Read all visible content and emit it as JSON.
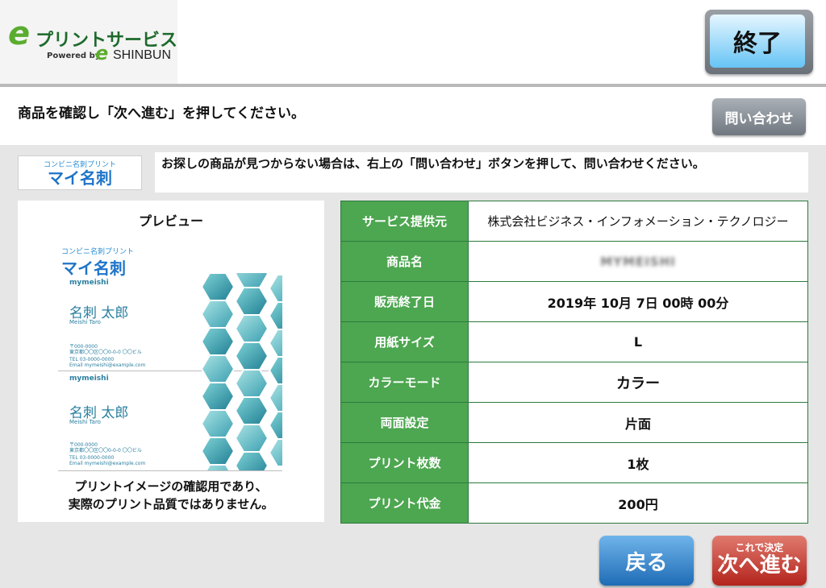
{
  "header": {
    "logo_e": "e",
    "logo_title": "プリントサービス",
    "logo_powered": "Powered by",
    "logo_e_small": "e",
    "logo_shinbun": "SHINBUN",
    "exit_label": "終了"
  },
  "instruction": {
    "text": "商品を確認し「次へ進む」を押してください。",
    "contact_label": "問い合わせ"
  },
  "brand": {
    "sub": "コンビニ名刺プリント",
    "main": "マイ名刺"
  },
  "notice": "お探しの商品が見つからない場合は、右上の「問い合わせ」ボタンを押して、問い合わせください。",
  "preview": {
    "title": "プレビュー",
    "note_line1": "プリントイメージの確認用であり、",
    "note_line2": "実際のプリント品質ではありません。",
    "card_brand_sub": "コンビニ名刺プリント",
    "card_brand_main": "マイ名刺",
    "card_site": "mymeishi",
    "card_name": "名刺 太郎",
    "card_name_roman": "Meishi Taro",
    "card_zip": "〒000-0000",
    "card_address": "東京都〇〇区〇〇0-0-0 〇〇ビル",
    "card_tel": "TEL 03-0000-0000",
    "card_email": "Email mymeishi@example.com"
  },
  "details": [
    {
      "label": "サービス提供元",
      "value": "株式会社ビジネス・インフォメーション・テクノロジー"
    },
    {
      "label": "商品名",
      "value": "MYMEISHI"
    },
    {
      "label": "販売終了日",
      "value": "2019年 10月 7日 00時 00分"
    },
    {
      "label": "用紙サイズ",
      "value": "L"
    },
    {
      "label": "カラーモード",
      "value": "カラー"
    },
    {
      "label": "両面設定",
      "value": "片面"
    },
    {
      "label": "プリント枚数",
      "value": "1枚"
    },
    {
      "label": "プリント代金",
      "value": "200円"
    }
  ],
  "footer": {
    "back_label": "戻る",
    "next_small": "これで決定",
    "next_big": "次へ進む"
  },
  "colors": {
    "label_green": "#4da650",
    "exit_blue": "#66c4f5",
    "back_blue": "#1f6cb6",
    "next_red": "#b3241d"
  }
}
